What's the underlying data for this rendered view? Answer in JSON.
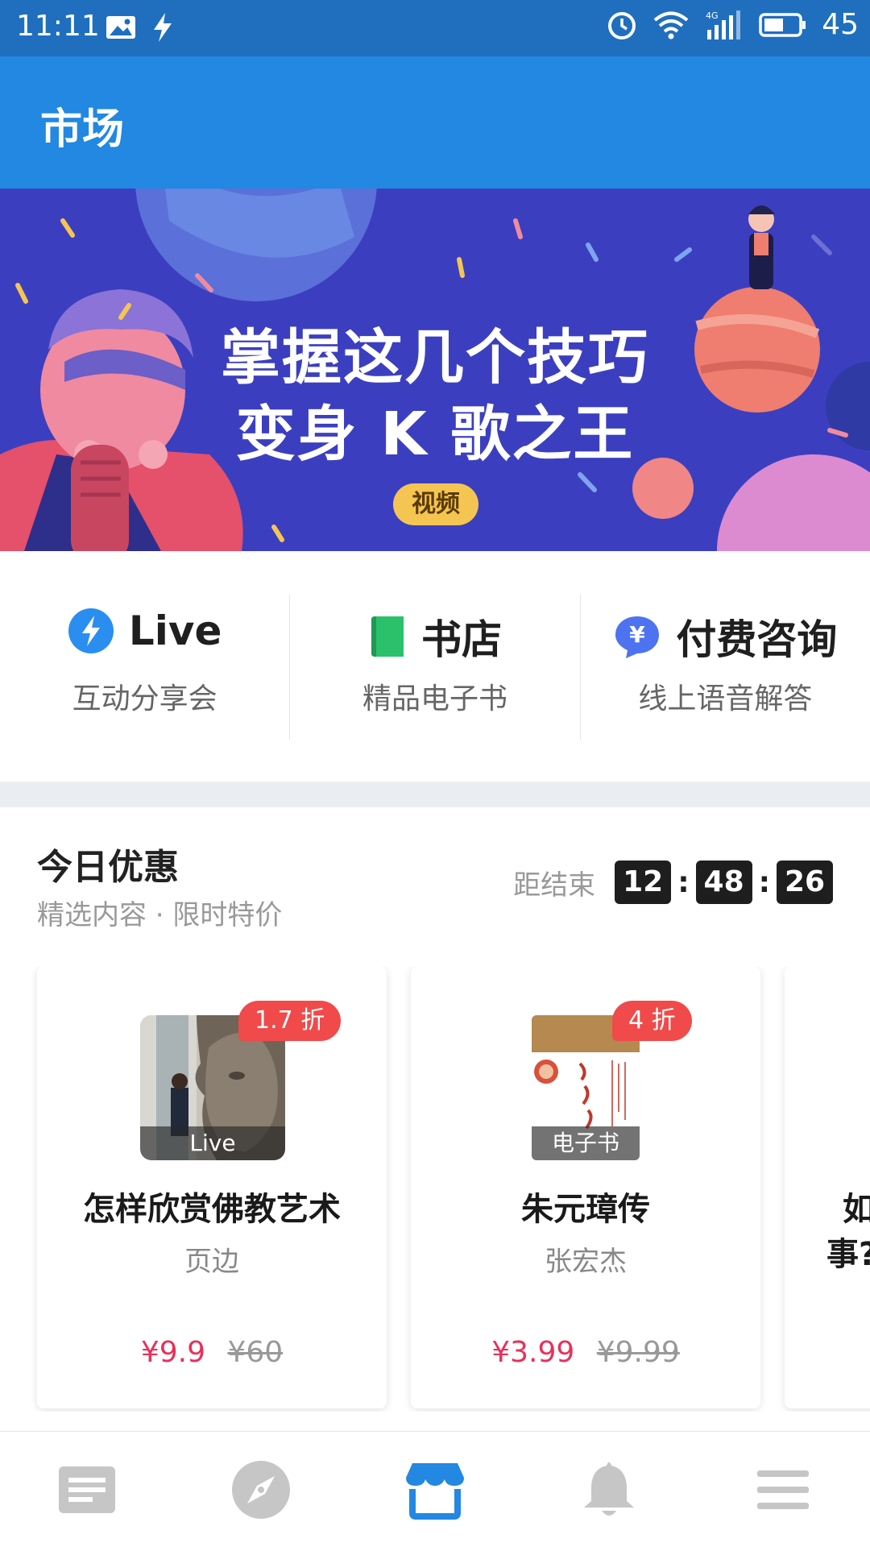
{
  "status_bar": {
    "time": "11:11",
    "battery": "45"
  },
  "app_bar": {
    "title": "市场"
  },
  "banner": {
    "line1": "掌握这几个技巧",
    "line2": "变身 K 歌之王",
    "tag": "视频"
  },
  "categories": [
    {
      "title": "Live",
      "subtitle": "互动分享会",
      "icon": "lightning-icon"
    },
    {
      "title": "书店",
      "subtitle": "精品电子书",
      "icon": "book-icon"
    },
    {
      "title": "付费咨询",
      "subtitle": "线上语音解答",
      "icon": "yen-chat-icon"
    }
  ],
  "deals": {
    "title": "今日优惠",
    "subtitle": "精选内容 · 限时特价",
    "countdown_label": "距结束",
    "countdown": {
      "h": "12",
      "m": "48",
      "s": "26"
    },
    "items": [
      {
        "title": "怎样欣赏佛教艺术",
        "author": "页边",
        "price": "¥9.9",
        "old_price": "¥60",
        "discount": "1.7 折",
        "cover_caption": "Live"
      },
      {
        "title": "朱元璋传",
        "author": "张宏杰",
        "price": "¥3.99",
        "old_price": "¥9.99",
        "discount": "4 折",
        "cover_caption": "电子书"
      },
      {
        "title": "如",
        "title2": "事?"
      }
    ]
  },
  "nav": [
    {
      "icon": "feed-icon",
      "active": false
    },
    {
      "icon": "compass-icon",
      "active": false
    },
    {
      "icon": "market-icon",
      "active": true
    },
    {
      "icon": "bell-icon",
      "active": false
    },
    {
      "icon": "menu-icon",
      "active": false
    }
  ],
  "colors": {
    "status_bar": "#1f6fbe",
    "app_bar": "#2288e1",
    "accent": "#2288e1",
    "price": "#e8305a",
    "discount": "#f04a4a"
  }
}
